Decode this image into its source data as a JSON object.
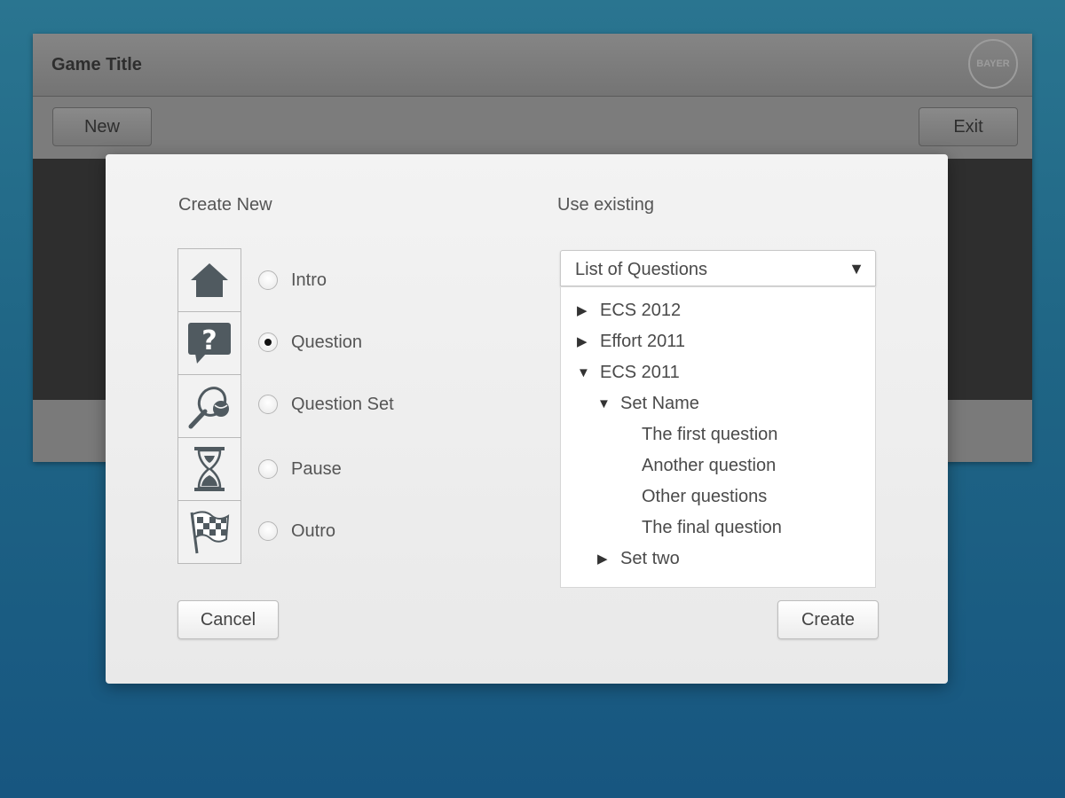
{
  "app": {
    "title": "Game Title",
    "logo_text": "BAYER",
    "toolbar": {
      "new_label": "New",
      "exit_label": "Exit"
    }
  },
  "dialog": {
    "create_heading": "Create New",
    "existing_heading": "Use existing",
    "options": [
      {
        "label": "Intro",
        "icon": "home-icon",
        "checked": false
      },
      {
        "label": "Question",
        "icon": "question-bubble-icon",
        "checked": true
      },
      {
        "label": "Question Set",
        "icon": "racket-ball-icon",
        "checked": false
      },
      {
        "label": "Pause",
        "icon": "hourglass-icon",
        "checked": false
      },
      {
        "label": "Outro",
        "icon": "checkered-flag-icon",
        "checked": false
      }
    ],
    "select": {
      "value": "List of Questions",
      "arrow": "▼"
    },
    "tree": [
      {
        "label": "ECS 2012",
        "toggle": "▶",
        "level": 0
      },
      {
        "label": "Effort 2011",
        "toggle": "▶",
        "level": 0
      },
      {
        "label": "ECS 2011",
        "toggle": "▼",
        "level": 0
      },
      {
        "label": "Set Name",
        "toggle": "▼",
        "level": 1
      },
      {
        "label": "The first question",
        "toggle": "",
        "level": 2
      },
      {
        "label": "Another question",
        "toggle": "",
        "level": 2
      },
      {
        "label": "Other questions",
        "toggle": "",
        "level": 2
      },
      {
        "label": "The final question",
        "toggle": "",
        "level": 2
      },
      {
        "label": "Set two",
        "toggle": "▶",
        "level": 1
      }
    ],
    "buttons": {
      "cancel_label": "Cancel",
      "create_label": "Create"
    }
  }
}
